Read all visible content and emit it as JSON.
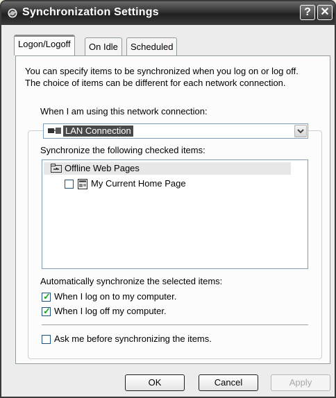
{
  "window": {
    "title": "Synchronization Settings",
    "help_glyph": "?",
    "close_glyph": "✕"
  },
  "tabs": [
    {
      "label": "Logon/Logoff",
      "active": true
    },
    {
      "label": "On Idle",
      "active": false
    },
    {
      "label": "Scheduled",
      "active": false
    }
  ],
  "panel": {
    "description_line1": "You can specify items to be synchronized when you log on or log off.",
    "description_line2": "The choice of items can be different for each network connection.",
    "connection_label": "When I am using this network connection:",
    "connection_value": "LAN Connection",
    "items_label": "Synchronize the following checked items:",
    "items": [
      {
        "label": "Offline Web Pages",
        "checked": null,
        "icon": "offline-web-pages-icon"
      },
      {
        "label": "My Current Home Page",
        "checked": false,
        "icon": "web-page-icon"
      }
    ],
    "auto_label": "Automatically synchronize the selected items:",
    "options": [
      {
        "label": "When I log on to my computer.",
        "checked": true
      },
      {
        "label": "When I log off my computer.",
        "checked": true
      },
      {
        "label": "Ask me before synchronizing the items.",
        "checked": false
      }
    ]
  },
  "buttons": {
    "ok": "OK",
    "cancel": "Cancel",
    "apply": "Apply"
  }
}
